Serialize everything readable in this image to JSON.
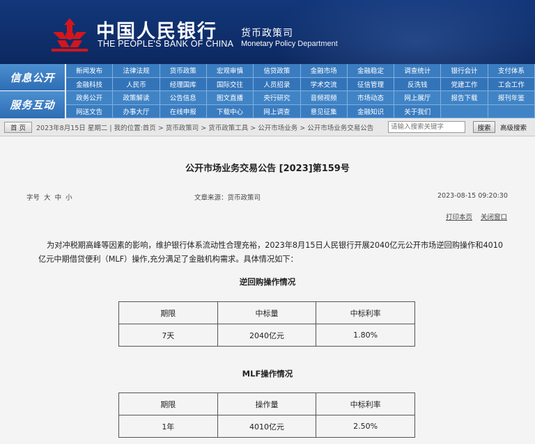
{
  "header": {
    "bank_name_cn": "中国人民银行",
    "bank_name_en": "THE PEOPLE'S BANK OF CHINA",
    "dept_cn": "货币政策司",
    "dept_en": "Monetary Policy Department",
    "logo_icon": "pboc-emblem-icon",
    "colors": {
      "header_bg": "#0f2f6c",
      "logo_red": "#d4161c",
      "nav_blue": "#3a7cc0"
    }
  },
  "nav": {
    "section1": "信息公开",
    "section2": "服务互动",
    "rows": [
      [
        "新闻发布",
        "法律法规",
        "货币政策",
        "宏观审慎",
        "信贷政策",
        "金融市场",
        "金融稳定",
        "调查统计",
        "银行会计",
        "支付体系"
      ],
      [
        "金融科技",
        "人民币",
        "经理国库",
        "国际交往",
        "人员招录",
        "学术交流",
        "征信管理",
        "反洗钱",
        "党建工作",
        "工会工作"
      ],
      [
        "政务公开",
        "政策解读",
        "公告信息",
        "图文直播",
        "央行研究",
        "音频视频",
        "市场动态",
        "网上展厅",
        "报告下载",
        "报刊年鉴"
      ],
      [
        "网送文告",
        "办事大厅",
        "在线申报",
        "下载中心",
        "网上调查",
        "意见征集",
        "金融知识",
        "关于我们"
      ]
    ]
  },
  "breadcrumb": {
    "home": "首 页",
    "text": "2023年8月15日 星期二 | 我的位置:首页 > 货币政策司 > 货币政策工具 > 公开市场业务 > 公开市场业务交易公告",
    "search_placeholder": "请输入搜索关键字",
    "search_button": "搜索",
    "advanced": "高级搜索"
  },
  "article": {
    "title": "公开市场业务交易公告 [2023]第159号",
    "font_size_label": "字号",
    "font_sizes": [
      "大",
      "中",
      "小"
    ],
    "source": "文章来源：货币政策司",
    "datetime": "2023-08-15 09:20:30",
    "print": "打印本页",
    "close": "关闭窗口",
    "paragraph": "为对冲税期高峰等因素的影响，维护银行体系流动性合理充裕，2023年8月15日人民银行开展2040亿元公开市场逆回购操作和4010亿元中期借贷便利（MLF）操作,充分满足了金融机构需求。具体情况如下：",
    "table1": {
      "title": "逆回购操作情况",
      "headers": [
        "期限",
        "中标量",
        "中标利率"
      ],
      "row": [
        "7天",
        "2040亿元",
        "1.80%"
      ]
    },
    "table2": {
      "title": "MLF操作情况",
      "headers": [
        "期限",
        "操作量",
        "中标利率"
      ],
      "row": [
        "1年",
        "4010亿元",
        "2.50%"
      ]
    }
  }
}
